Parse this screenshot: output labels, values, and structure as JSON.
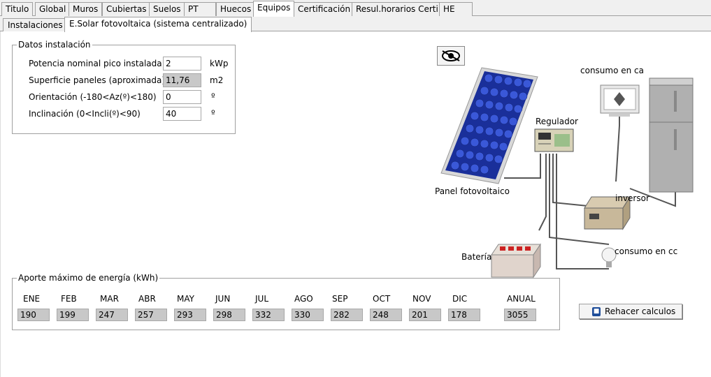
{
  "tabs": [
    "Titulo",
    "Global",
    "Muros",
    "Cubiertas",
    "Suelos",
    "PT",
    "Huecos",
    "Equipos",
    "Certificación",
    "Resul.horarios Certi",
    "HE"
  ],
  "subtabs": [
    "Instalaciones",
    "E.Solar fotovoltaica (sistema centralizado)"
  ],
  "datos": {
    "legend": "Datos instalación",
    "rows": [
      {
        "label": "Potencia nominal pico instalada",
        "value": "2",
        "unit": "kWp"
      },
      {
        "label": "Superficie paneles (aproximada)",
        "value": "11,76",
        "unit": "m2"
      },
      {
        "label": "Orientación (-180<Az(º)<180)",
        "value": "0",
        "unit": "º"
      },
      {
        "label": "Inclinación (0<Incli(º)<90)",
        "value": "40",
        "unit": "º"
      }
    ]
  },
  "aporte": {
    "legend": "Aporte máximo de energía (kWh)",
    "months": [
      {
        "label": "ENE",
        "value": "190"
      },
      {
        "label": "FEB",
        "value": "199"
      },
      {
        "label": "MAR",
        "value": "247"
      },
      {
        "label": "ABR",
        "value": "257"
      },
      {
        "label": "MAY",
        "value": "293"
      },
      {
        "label": "JUN",
        "value": "298"
      },
      {
        "label": "JUL",
        "value": "332"
      },
      {
        "label": "AGO",
        "value": "330"
      },
      {
        "label": "SEP",
        "value": "282"
      },
      {
        "label": "OCT",
        "value": "248"
      },
      {
        "label": "NOV",
        "value": "201"
      },
      {
        "label": "DIC",
        "value": "178"
      }
    ],
    "anual_label": "ANUAL",
    "anual_value": "3055"
  },
  "rehacer_button": "Rehacer calculos",
  "diagram": {
    "consumo_ca": "consumo en ca",
    "regulador": "Regulador",
    "panel": "Panel fotovoltaico",
    "inversor": "inversor",
    "bateria": "Batería",
    "consumo_cc": "consumo en cc"
  },
  "colors": {
    "readonly_bg": "#c8c8c8",
    "panel_blue": "#1a2f9a",
    "tab_bg": "#f0f0f0"
  }
}
